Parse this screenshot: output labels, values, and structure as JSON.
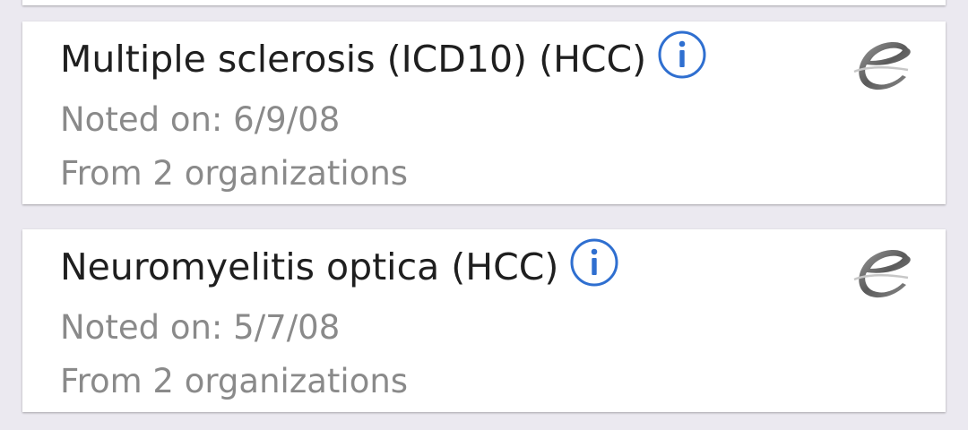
{
  "conditions": [
    {
      "title": "Multiple sclerosis (ICD10) (HCC)",
      "noted_on": "Noted on: 6/9/08",
      "organizations": "From 2 organizations",
      "info_icon": "info-icon",
      "source_icon": "source-logo-icon"
    },
    {
      "title": "Neuromyelitis optica (HCC)",
      "noted_on": "Noted on: 5/7/08",
      "organizations": "From 2 organizations",
      "info_icon": "info-icon",
      "source_icon": "source-logo-icon"
    }
  ],
  "colors": {
    "background": "#ebe9f0",
    "card": "#ffffff",
    "title_text": "#1f1f1f",
    "meta_text": "#8a8a8a",
    "info_blue": "#2f6fd0"
  }
}
